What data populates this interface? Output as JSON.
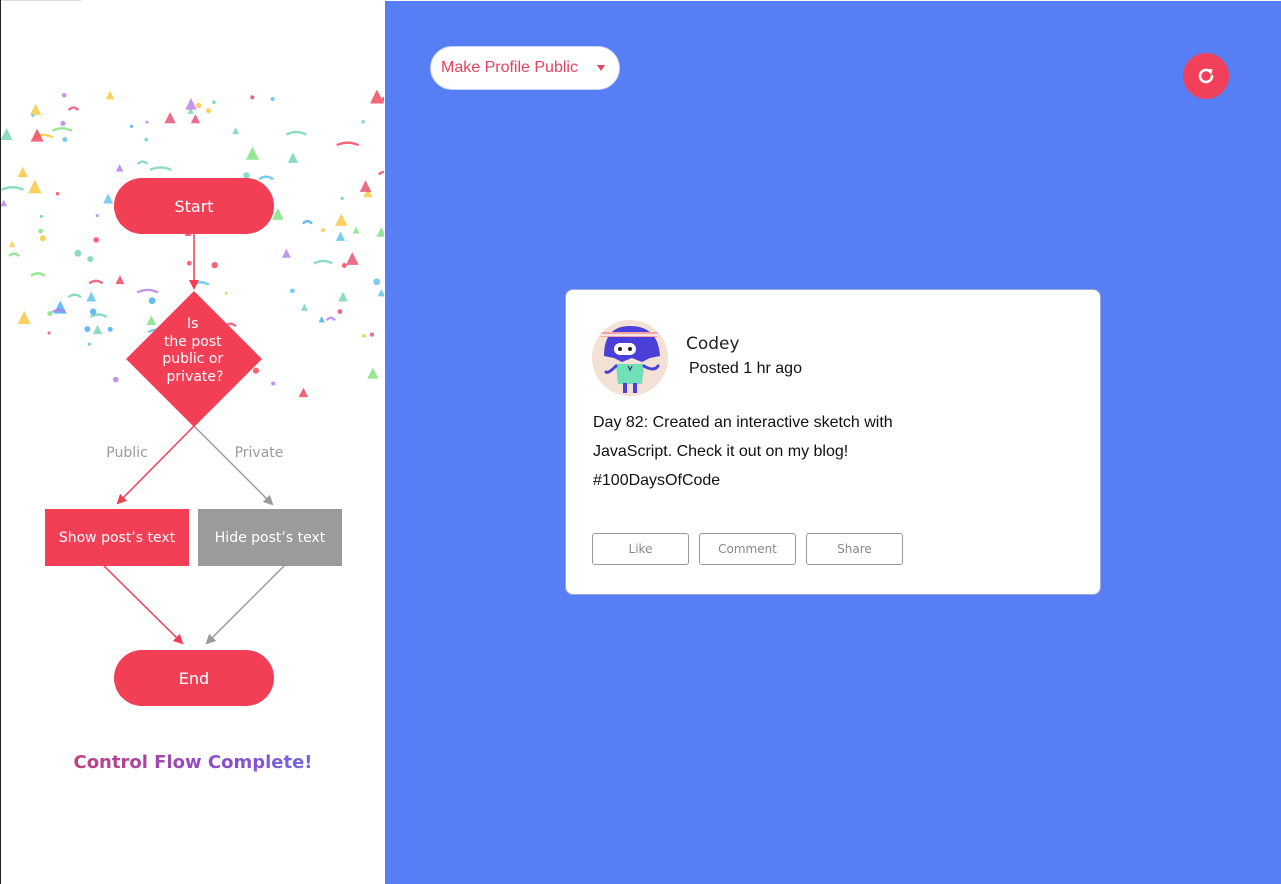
{
  "flowchart": {
    "start_label": "Start",
    "decision_lines": [
      "Is",
      "the post",
      "public or",
      "private?"
    ],
    "public_label": "Public",
    "private_label": "Private",
    "show_text_label": "Show post’s text",
    "hide_text_label": "Hide post’s text",
    "end_label": "End",
    "complete_message": "Control Flow Complete!"
  },
  "colors": {
    "accent_red": "#f23f56",
    "gray_box": "#9b9b9b",
    "right_panel_bg": "#587ef5"
  },
  "toolbar": {
    "privacy_select_value": "Make Profile Public",
    "refresh_icon": "refresh-icon"
  },
  "post": {
    "author": "Codey",
    "time": "Posted 1 hr ago",
    "body_lines": [
      "Day 82: Created an interactive sketch with",
      "JavaScript. Check it out on my blog!",
      "#100DaysOfCode"
    ],
    "actions": {
      "like": "Like",
      "comment": "Comment",
      "share": "Share"
    }
  }
}
